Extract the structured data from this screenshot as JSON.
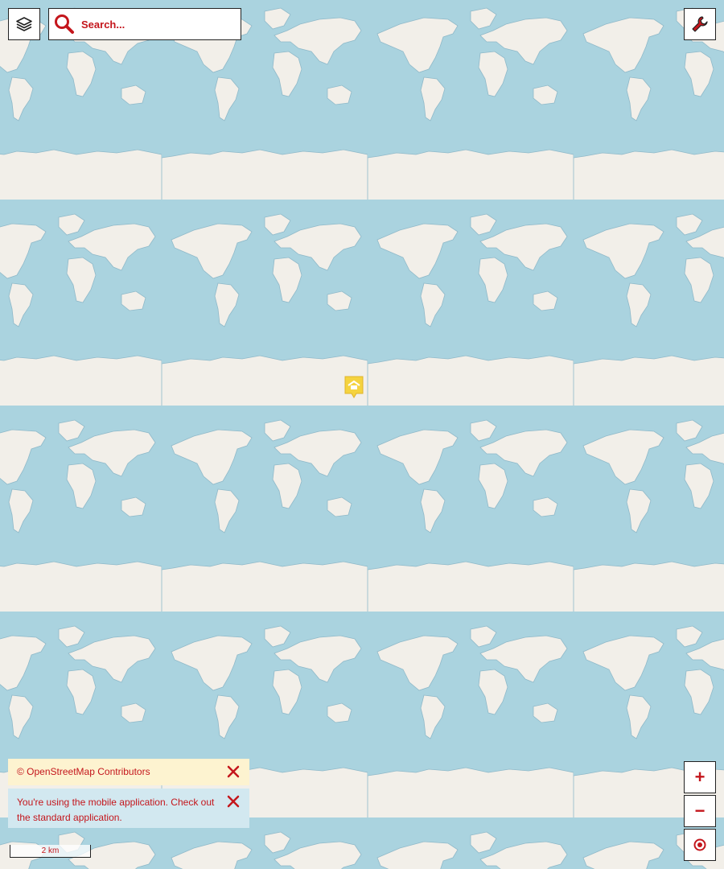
{
  "search": {
    "placeholder": "Search..."
  },
  "attribution": {
    "text": "© OpenStreetMap Contributors"
  },
  "mobile_notice": {
    "text": "You're using the mobile application. Check out the standard application."
  },
  "zoom": {
    "in_label": "+",
    "out_label": "−"
  },
  "scale": {
    "label": "2 km"
  },
  "icons": {
    "layers": "layers-icon",
    "search": "search-icon",
    "settings": "wrench-icon",
    "close": "close-icon",
    "locate": "locate-icon",
    "marker": "shelter-marker-icon"
  },
  "colors": {
    "water": "#aad3df",
    "land": "#f2efe9",
    "accent": "#c4161c",
    "marker": "#f5d33f"
  }
}
